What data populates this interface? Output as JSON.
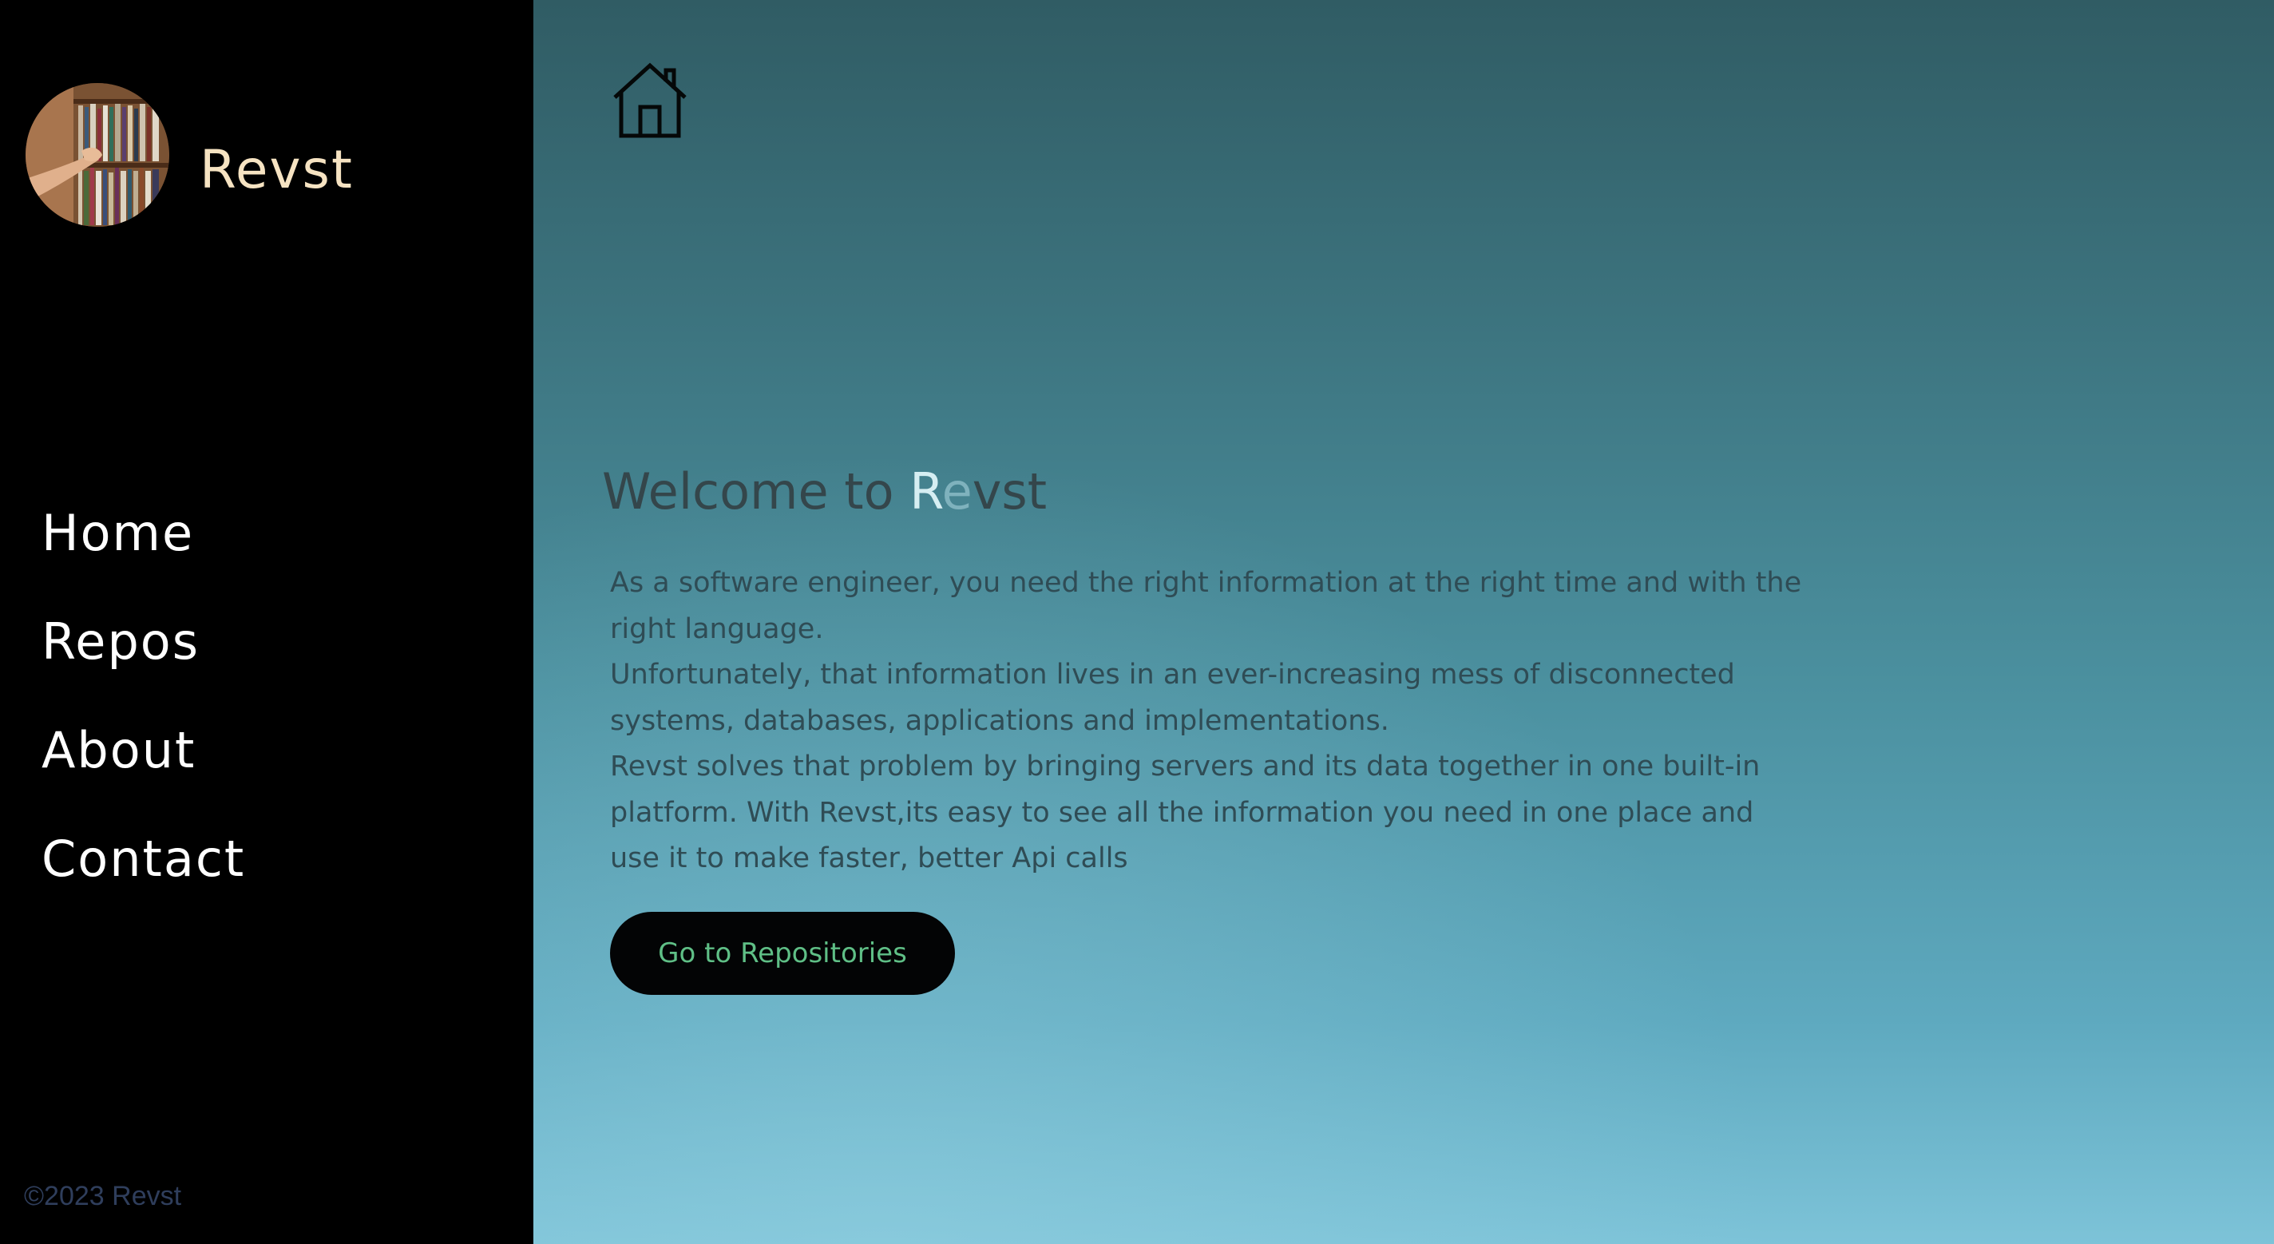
{
  "sidebar": {
    "brand": "Revst",
    "nav": [
      {
        "label": "Home"
      },
      {
        "label": "Repos"
      },
      {
        "label": "About"
      },
      {
        "label": "Contact"
      }
    ],
    "copyright": "©2023 Revst"
  },
  "main": {
    "home_icon": "home-icon",
    "title": {
      "prefix": "Welcome to ",
      "highlight_1": "R",
      "highlight_2": "e",
      "suffix": "vst"
    },
    "paragraphs": [
      "As a software engineer, you need the right information at the right time and with the right language.",
      "Unfortunately, that information lives in an ever-increasing mess of disconnected systems, databases, applications and implementations.",
      "Revst solves that problem by bringing servers and its data together in one built-in platform. With Revst,its easy to see all the information you need in one place and use it to make faster, better Api calls"
    ],
    "cta_label": "Go to Repositories"
  },
  "colors": {
    "sidebar_bg": "#000000",
    "brand": "#f6e3c2",
    "nav_text": "#ffffff",
    "copyright": "#2f3e5c",
    "main_top": "#305c64",
    "main_bottom": "#7dc3d8",
    "body_text": "#2f4c55",
    "button_bg": "#030405",
    "button_text": "#5fbf86"
  }
}
